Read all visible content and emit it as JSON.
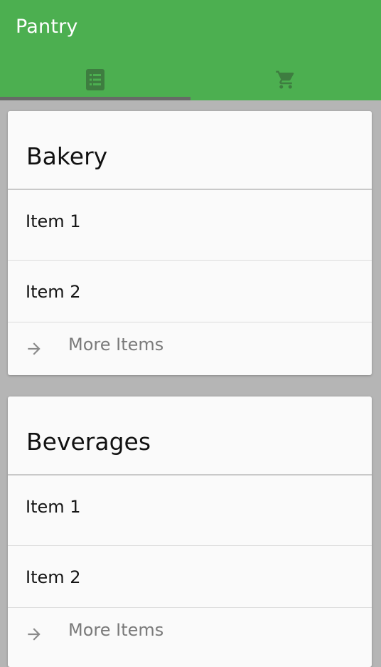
{
  "app": {
    "title": "Pantry",
    "brand_color": "#4caf50"
  },
  "tabs": [
    {
      "icon": "list-icon",
      "selected": true
    },
    {
      "icon": "shopping-cart-icon",
      "selected": false
    }
  ],
  "categories": [
    {
      "title": "Bakery",
      "items": [
        "Item 1",
        "Item 2"
      ],
      "more_label": "More Items"
    },
    {
      "title": "Beverages",
      "items": [
        "Item 1",
        "Item 2"
      ],
      "more_label": "More Items"
    }
  ]
}
